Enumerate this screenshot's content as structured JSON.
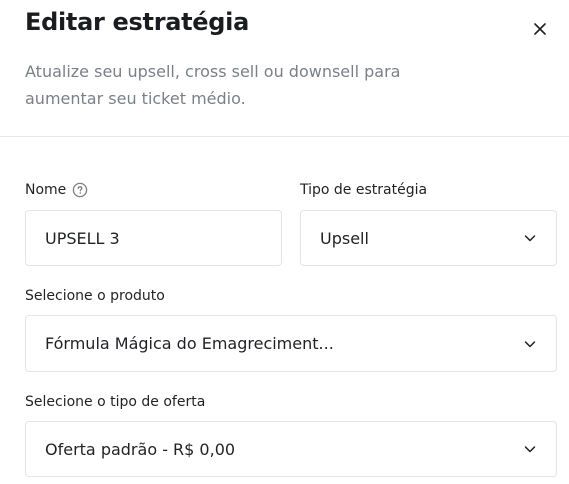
{
  "modal": {
    "title": "Editar estratégia",
    "subtitle": "Atualize seu upsell, cross sell ou downsell para aumentar seu ticket médio.",
    "close_icon": "close-icon"
  },
  "form": {
    "name": {
      "label": "Nome",
      "value": "UPSELL 3",
      "help_icon": "question-circle-icon"
    },
    "strategy_type": {
      "label": "Tipo de estratégia",
      "value": "Upsell"
    },
    "product": {
      "label": "Selecione o produto",
      "value": "Fórmula Mágica do Emagreciment..."
    },
    "offer_type": {
      "label": "Selecione o tipo de oferta",
      "value": "Oferta padrão - R$ 0,00"
    }
  },
  "colors": {
    "text": "#1f2125",
    "muted": "#7a7f88",
    "border": "#e1e4e8",
    "divider": "#e6e8eb"
  }
}
